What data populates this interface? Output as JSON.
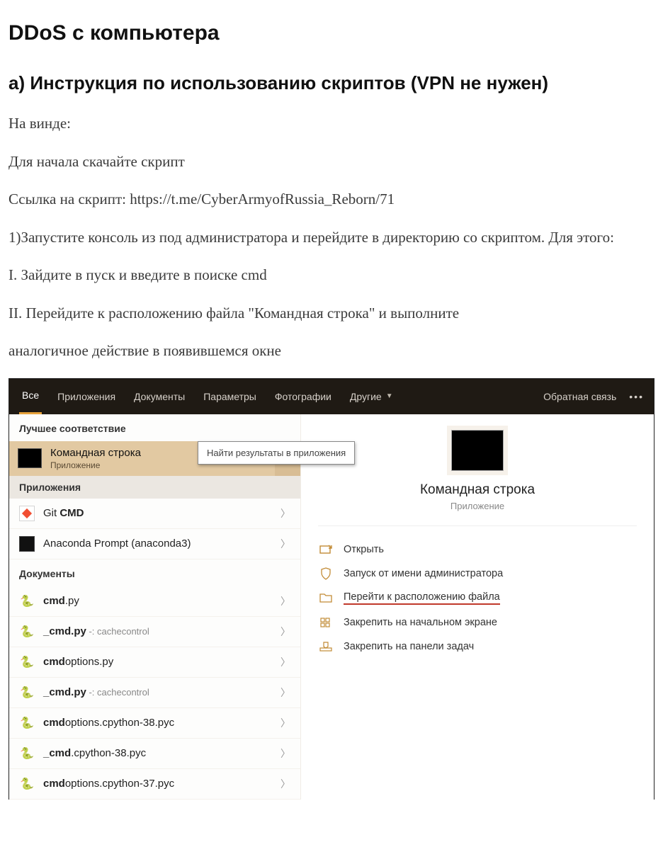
{
  "title": "DDoS с компьютера",
  "section": "а) Инструкция по использованию скриптов (VPN не нужен)",
  "paragraphs": {
    "p1": "На винде:",
    "p2": "Для начала скачайте скрипт",
    "p3": "Ссылка на скрипт: https://t.me/CyberArmyofRussia_Reborn/71",
    "p4": "1)Запустите консоль из под администратора и перейдите в директорию со скриптом. Для этого:",
    "p5": "I. Зайдите в пуск и введите в поиске cmd",
    "p6": "II. Перейдите к расположению файла \"Командная строка\" и выполните",
    "p7": "аналогичное действие в появившемся окне"
  },
  "win": {
    "tabs": {
      "all": "Все",
      "apps": "Приложения",
      "docs": "Документы",
      "params": "Параметры",
      "photos": "Фотографии",
      "other": "Другие"
    },
    "feedback": "Обратная связь",
    "best_label": "Лучшее соответствие",
    "best": {
      "title": "Командная строка",
      "subtitle": "Приложение"
    },
    "tooltip": "Найти результаты в приложения",
    "apps_label": "Приложения",
    "apps": [
      {
        "label_pre": "Git ",
        "label_bold": "CMD",
        "hint": ""
      },
      {
        "label_pre": "Anaconda Prompt (anaconda3)",
        "label_bold": "",
        "hint": ""
      }
    ],
    "docs_label": "Документы",
    "doc_items": [
      {
        "name_pre": "cmd",
        "name_post": ".py",
        "hint": ""
      },
      {
        "name_pre": "_cmd.py",
        "name_post": "",
        "hint": " -: cachecontrol"
      },
      {
        "name_pre": "cmd",
        "name_post": "options.py",
        "hint": ""
      },
      {
        "name_pre": "_cmd.py",
        "name_post": "",
        "hint": " -: cachecontrol"
      },
      {
        "name_pre": "cmd",
        "name_post": "options.cpython-38.pyc",
        "hint": ""
      },
      {
        "name_pre": "_cmd",
        "name_post": ".cpython-38.pyc",
        "hint": ""
      },
      {
        "name_pre": "cmd",
        "name_post": "options.cpython-37.pyc",
        "hint": ""
      }
    ],
    "pane": {
      "title": "Командная строка",
      "subtitle": "Приложение",
      "actions": {
        "open": "Открыть",
        "runas": "Запуск от имени администратора",
        "goto": "Перейти к расположению файла",
        "pin_start": "Закрепить на начальном экране",
        "pin_task": "Закрепить на панели задач"
      }
    }
  }
}
